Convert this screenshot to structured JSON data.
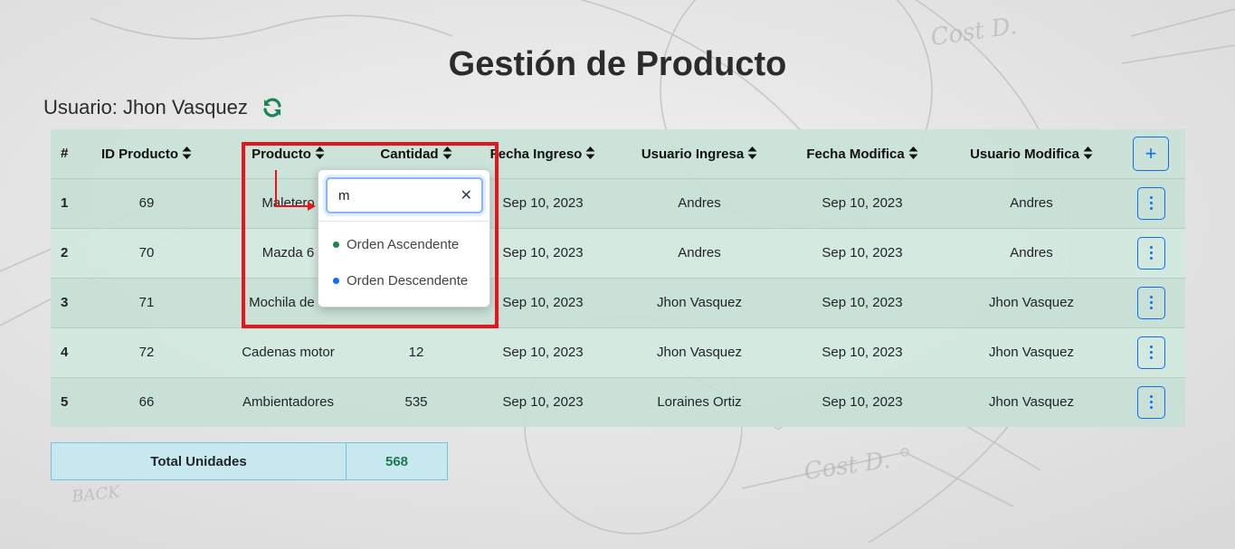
{
  "page": {
    "title": "Gestión de Producto"
  },
  "user": {
    "label": "Usuario: Jhon Vasquez"
  },
  "icons": {
    "refresh": "refresh-icon",
    "sort": "sort-icon",
    "add": "plus-icon",
    "menu": "kebab-menu-icon",
    "clear": "close-icon"
  },
  "colors": {
    "accent": "#0d6efd",
    "success": "#198754",
    "highlight": "#e8141a"
  },
  "table": {
    "headers": {
      "num": "#",
      "id": "ID Producto",
      "product": "Producto",
      "quantity": "Cantidad",
      "date_in": "Fecha Ingreso",
      "user_in": "Usuario Ingresa",
      "date_mod": "Fecha Modifica",
      "user_mod": "Usuario Modifica",
      "add": "+"
    },
    "rows": [
      {
        "num": "1",
        "id": "69",
        "product": "Maletero",
        "quantity": "",
        "date_in": "Sep 10, 2023",
        "user_in": "Andres",
        "date_mod": "Sep 10, 2023",
        "user_mod": "Andres"
      },
      {
        "num": "2",
        "id": "70",
        "product": "Mazda 6",
        "quantity": "",
        "date_in": "Sep 10, 2023",
        "user_in": "Andres",
        "date_mod": "Sep 10, 2023",
        "user_mod": "Andres"
      },
      {
        "num": "3",
        "id": "71",
        "product": "Mochila de V",
        "quantity": "",
        "date_in": "Sep 10, 2023",
        "user_in": "Jhon Vasquez",
        "date_mod": "Sep 10, 2023",
        "user_mod": "Jhon Vasquez"
      },
      {
        "num": "4",
        "id": "72",
        "product": "Cadenas motor",
        "quantity": "12",
        "date_in": "Sep 10, 2023",
        "user_in": "Jhon Vasquez",
        "date_mod": "Sep 10, 2023",
        "user_mod": "Jhon Vasquez"
      },
      {
        "num": "5",
        "id": "66",
        "product": "Ambientadores",
        "quantity": "535",
        "date_in": "Sep 10, 2023",
        "user_in": "Loraines Ortiz",
        "date_mod": "Sep 10, 2023",
        "user_mod": "Jhon Vasquez"
      }
    ]
  },
  "total": {
    "label": "Total Unidades",
    "value": "568"
  },
  "filter_popup": {
    "input_value": "m",
    "clear_label": "✕",
    "options": [
      {
        "label": "Orden Ascendente",
        "color": "#198754"
      },
      {
        "label": "Orden Descendente",
        "color": "#0d6efd"
      }
    ]
  }
}
